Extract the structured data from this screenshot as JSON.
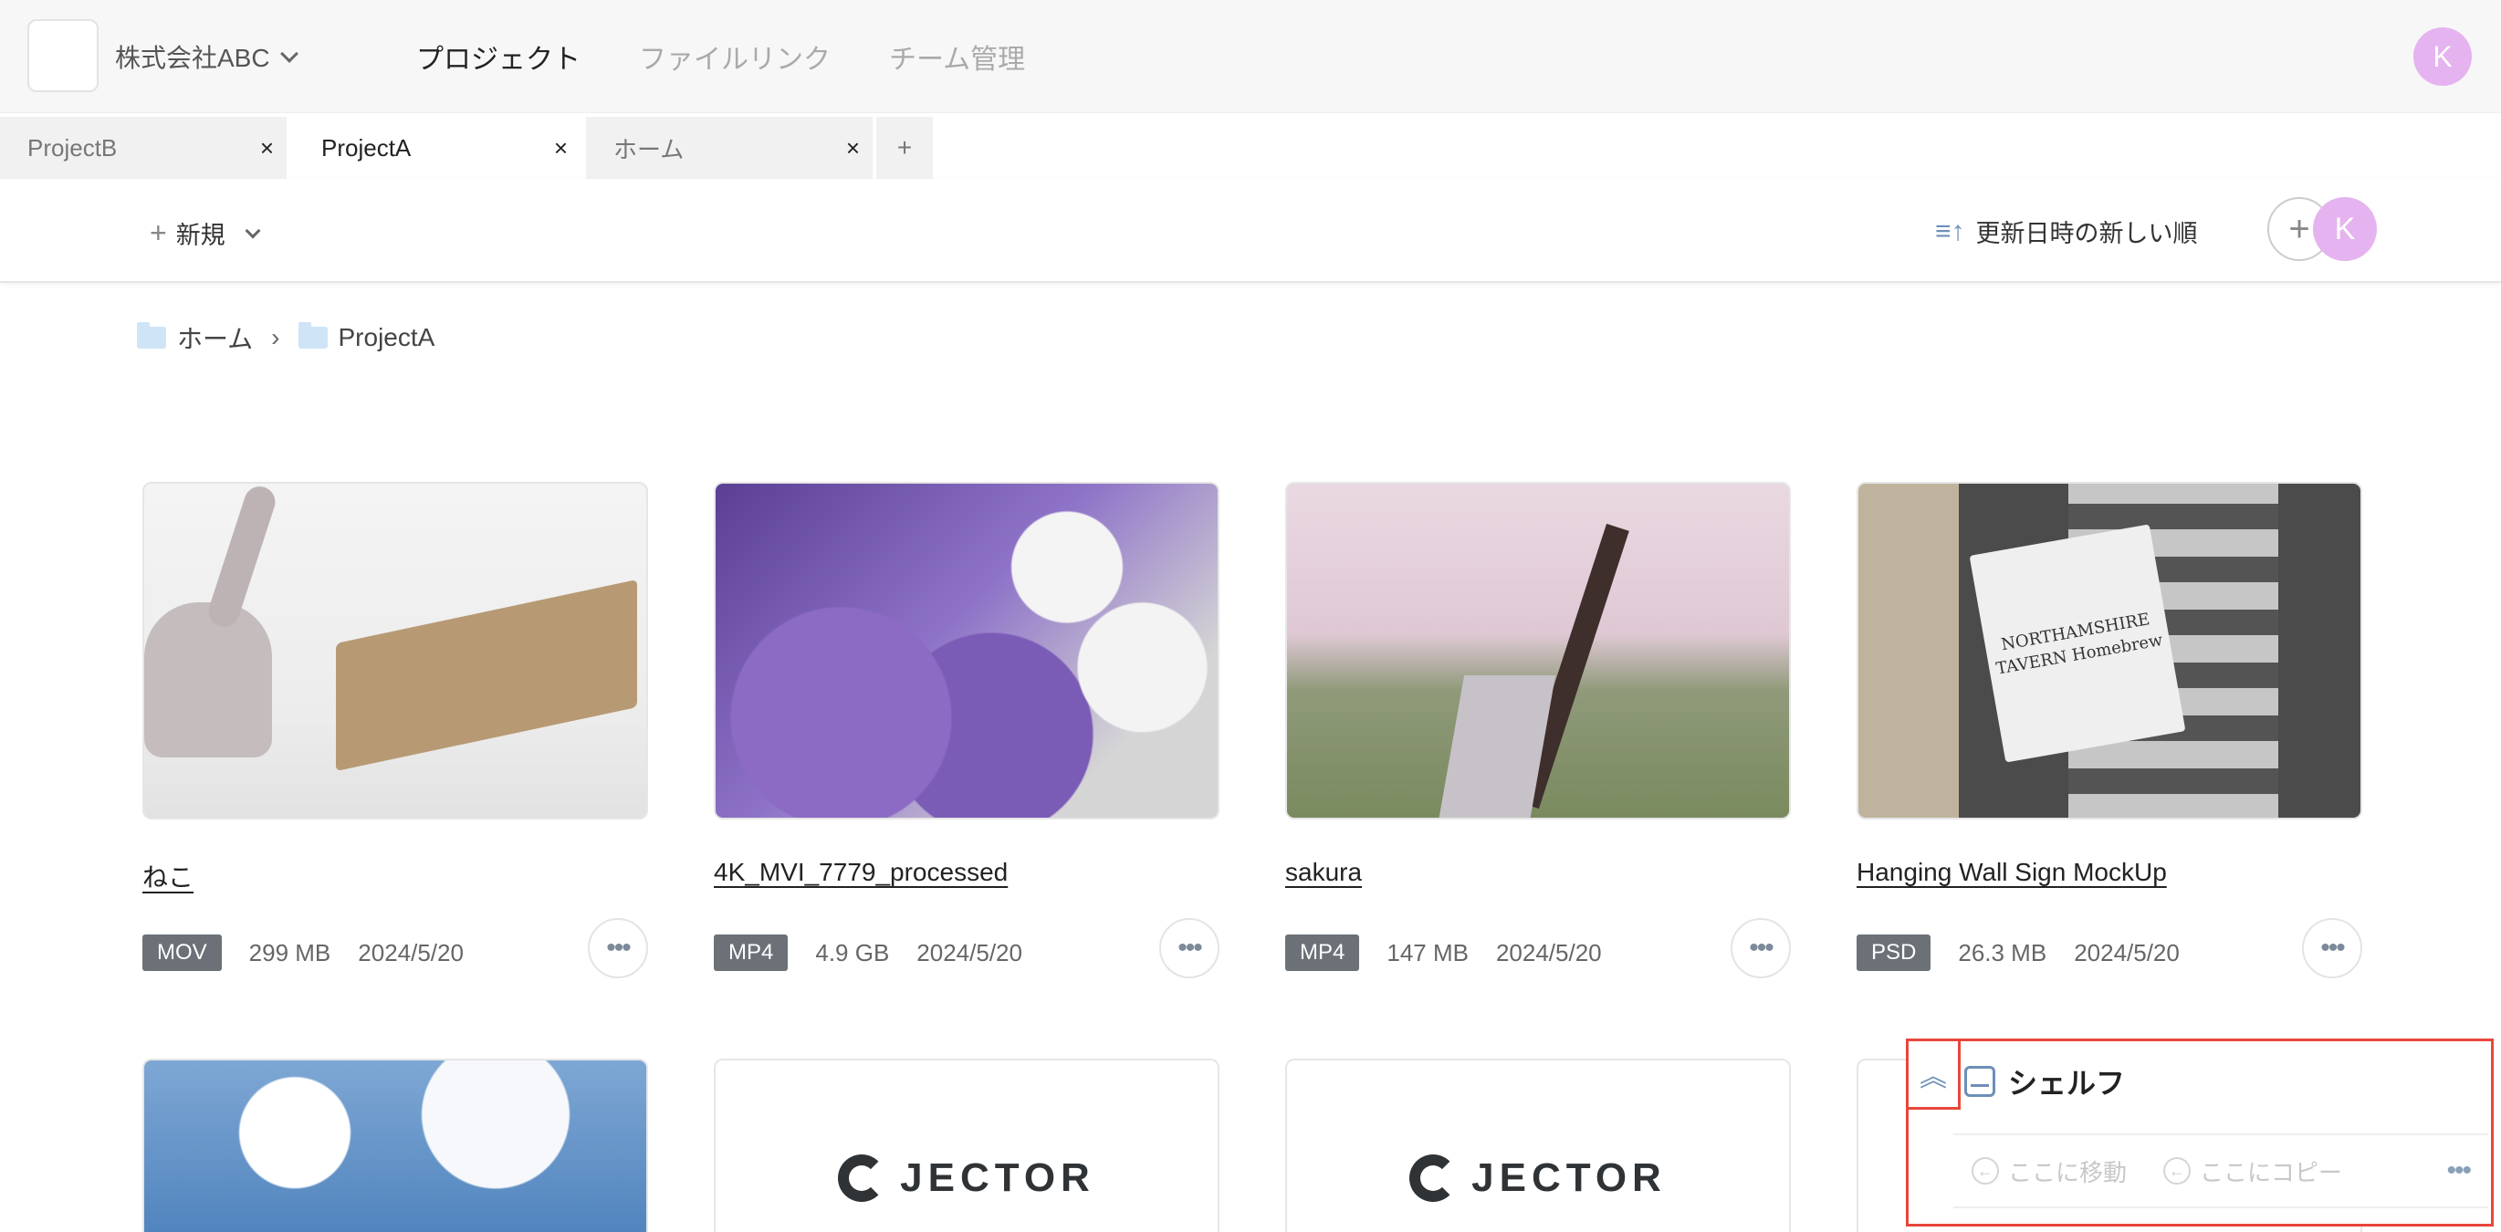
{
  "header": {
    "company": "株式会社ABC",
    "nav": [
      "プロジェクト",
      "ファイルリンク",
      "チーム管理"
    ],
    "active_nav": 0,
    "user_initial": "K"
  },
  "tabs": [
    {
      "label": "ProjectB",
      "close": "×"
    },
    {
      "label": "ProjectA",
      "close": "×"
    },
    {
      "label": "ホーム",
      "close": "×"
    }
  ],
  "tab_add": "+",
  "toolbar": {
    "new_label": "新規",
    "new_plus": "+",
    "sort_label": "更新日時の新しい順",
    "add_member": "+",
    "member_initial": "K"
  },
  "breadcrumb": {
    "items": [
      "ホーム",
      "ProjectA"
    ],
    "separator": "›"
  },
  "files": [
    {
      "name": "ねこ",
      "type": "MOV",
      "size": "299 MB",
      "date": "2024/5/20"
    },
    {
      "name": "4K_MVI_7779_processed",
      "type": "MP4",
      "size": "4.9 GB",
      "date": "2024/5/20"
    },
    {
      "name": "sakura",
      "type": "MP4",
      "size": "147 MB",
      "date": "2024/5/20"
    },
    {
      "name": "Hanging Wall Sign MockUp",
      "type": "PSD",
      "size": "26.3 MB",
      "date": "2024/5/20"
    }
  ],
  "more_label": "•••",
  "jector_text": "JECTOR",
  "sign_text": "NORTHAMSHIRE TAVERN Homebrew",
  "shelf": {
    "title": "シェルフ",
    "collapse_icon": "︽",
    "move_here": "ここに移動",
    "copy_here": "ここにコピー",
    "more": "•••",
    "arrow": "←"
  },
  "colors": {
    "accent": "#6d8fb8",
    "avatar": "#e5b3ef",
    "highlight": "#e8473b",
    "badge": "#6b7177"
  }
}
